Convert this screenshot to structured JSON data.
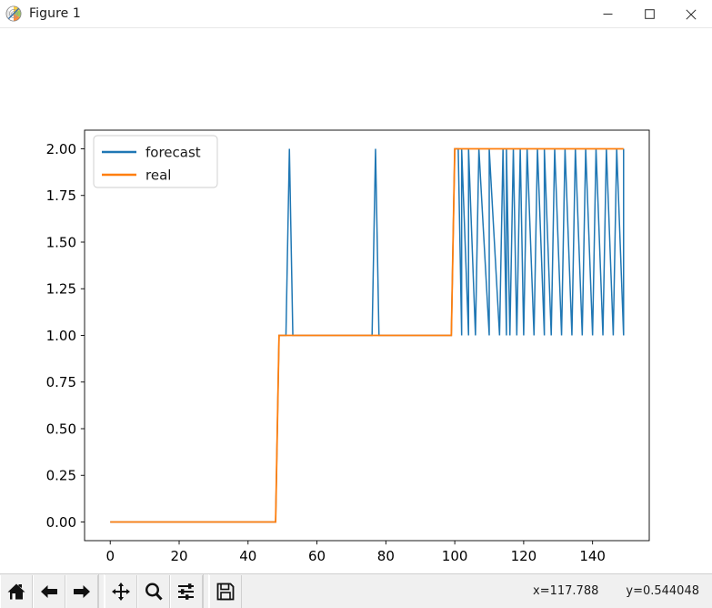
{
  "window": {
    "title": "Figure 1",
    "icon": "matplotlib-logo-icon",
    "minimize_label": "—",
    "maximize_label": "□",
    "close_label": "✕"
  },
  "toolbar": {
    "buttons": [
      {
        "name": "home-icon",
        "tooltip": "Reset original view"
      },
      {
        "name": "back-arrow-icon",
        "tooltip": "Back to previous view"
      },
      {
        "name": "forward-arrow-icon",
        "tooltip": "Forward to next view"
      },
      {
        "name": "pan-move-icon",
        "tooltip": "Pan axes with left mouse, zoom with right"
      },
      {
        "name": "zoom-magnifier-icon",
        "tooltip": "Zoom to rectangle"
      },
      {
        "name": "configure-subplots-sliders-icon",
        "tooltip": "Configure subplots"
      },
      {
        "name": "save-floppy-icon",
        "tooltip": "Save the figure"
      }
    ],
    "coord_x": "x=117.788",
    "coord_y": "y=0.544048"
  },
  "colors": {
    "forecast": "#1f77b4",
    "real": "#ff7f0e",
    "axes": "#000000",
    "background": "#ffffff",
    "toolbar_bg": "#f0f0f0",
    "tick_label": "#000000"
  },
  "chart_data": {
    "type": "line",
    "title": "",
    "xlabel": "",
    "ylabel": "",
    "xlim": [
      -7.45,
      156.45
    ],
    "ylim": [
      -0.1,
      2.1
    ],
    "xticks": [
      0,
      20,
      40,
      60,
      80,
      100,
      120,
      140
    ],
    "xtick_labels": [
      "0",
      "20",
      "40",
      "60",
      "80",
      "100",
      "120",
      "140"
    ],
    "yticks": [
      0.0,
      0.25,
      0.5,
      0.75,
      1.0,
      1.25,
      1.5,
      1.75,
      2.0
    ],
    "ytick_labels": [
      "0.00",
      "0.25",
      "0.50",
      "0.75",
      "1.00",
      "1.25",
      "1.50",
      "1.75",
      "2.00"
    ],
    "grid": false,
    "legend": {
      "position": "upper left",
      "entries": [
        "forecast",
        "real"
      ]
    },
    "series": [
      {
        "name": "forecast",
        "color": "#1f77b4",
        "linewidth": 1.5,
        "note": "step-like class prediction: 0 until ~49, then 1 with isolated spikes to 2 at x=52 and x=77, then 2 from ~100 onward with frequent drops to 1",
        "points": [
          [
            0,
            0
          ],
          [
            48,
            0
          ],
          [
            49,
            1
          ],
          [
            51,
            1
          ],
          [
            52,
            2
          ],
          [
            53,
            1
          ],
          [
            76,
            1
          ],
          [
            77,
            2
          ],
          [
            78,
            1
          ],
          [
            99,
            1
          ],
          [
            100,
            2
          ],
          [
            101,
            2
          ],
          [
            102,
            1
          ],
          [
            102,
            2
          ],
          [
            104,
            1
          ],
          [
            104,
            2
          ],
          [
            106,
            1
          ],
          [
            107,
            2
          ],
          [
            110,
            1
          ],
          [
            110,
            2
          ],
          [
            113,
            1
          ],
          [
            114,
            2
          ],
          [
            115,
            1
          ],
          [
            115,
            2
          ],
          [
            116,
            1
          ],
          [
            117,
            2
          ],
          [
            118,
            1
          ],
          [
            119,
            2
          ],
          [
            120,
            1
          ],
          [
            121,
            2
          ],
          [
            123,
            1
          ],
          [
            124,
            2
          ],
          [
            126,
            1
          ],
          [
            126,
            2
          ],
          [
            128,
            1
          ],
          [
            129,
            2
          ],
          [
            131,
            1
          ],
          [
            132,
            2
          ],
          [
            134,
            1
          ],
          [
            135,
            2
          ],
          [
            137,
            1
          ],
          [
            138,
            2
          ],
          [
            140,
            1
          ],
          [
            141,
            2
          ],
          [
            143,
            1
          ],
          [
            144,
            2
          ],
          [
            146,
            1
          ],
          [
            147,
            2
          ],
          [
            149,
            1
          ],
          [
            149,
            2
          ]
        ]
      },
      {
        "name": "real",
        "color": "#ff7f0e",
        "linewidth": 1.8,
        "note": "true class: 0 until x=48, 1 from x=49 to x=99, 2 from x=100 to x=149",
        "points": [
          [
            0,
            0
          ],
          [
            48,
            0
          ],
          [
            49,
            1
          ],
          [
            99,
            1
          ],
          [
            100,
            2
          ],
          [
            149,
            2
          ]
        ]
      }
    ]
  }
}
